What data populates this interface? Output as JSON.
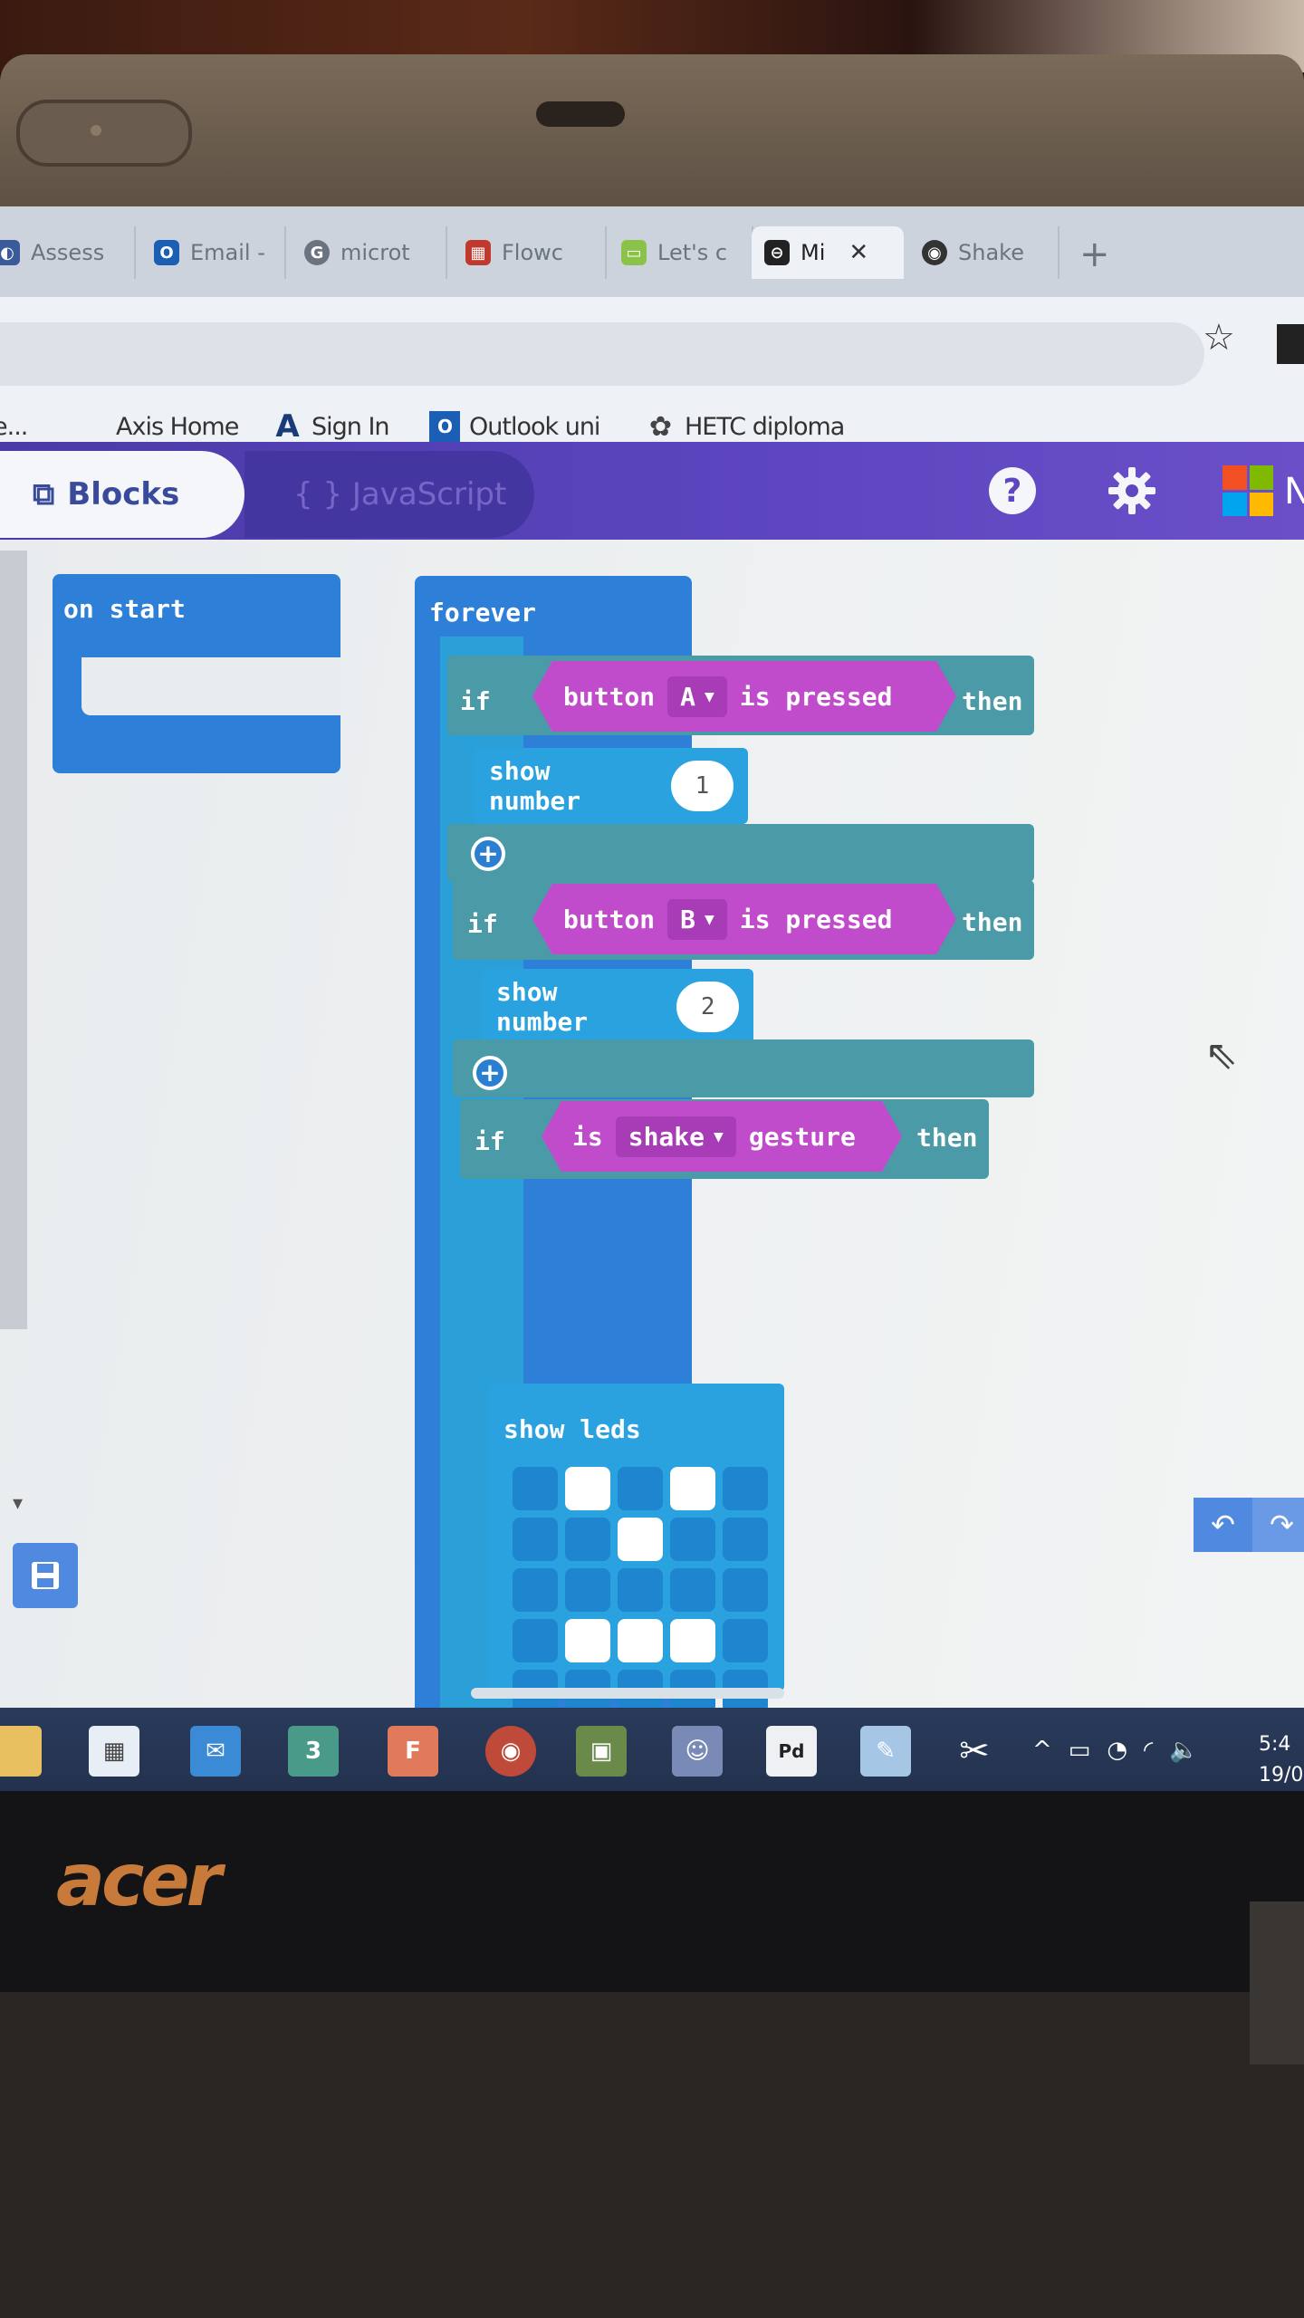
{
  "browser": {
    "tabs": [
      {
        "label": "Assess",
        "icon": "assess-icon",
        "color": "#3a5a9a"
      },
      {
        "label": "Email -",
        "icon": "outlook-icon",
        "color": "#1a5fb4"
      },
      {
        "label": "microt",
        "icon": "google-icon",
        "color": "#555555"
      },
      {
        "label": "Flowc",
        "icon": "flowchart-icon",
        "color": "#c0392b"
      },
      {
        "label": "Let's c",
        "icon": "letsc-icon",
        "color": "#4caf50"
      },
      {
        "label": "Mi",
        "icon": "microbit-icon",
        "color": "#222222",
        "active": true
      },
      {
        "label": "Shake",
        "icon": "github-icon",
        "color": "#333333"
      }
    ],
    "new_tab": "+",
    "bookmarks": [
      {
        "label": "e...",
        "icon": ""
      },
      {
        "label": "Axis Home",
        "icon": ""
      },
      {
        "label": "Sign In",
        "icon": "sign-in-icon"
      },
      {
        "label": "Outlook uni",
        "icon": "outlook-icon"
      },
      {
        "label": "HETC diploma",
        "icon": "hetc-icon"
      }
    ]
  },
  "editor": {
    "blocks_tab": "Blocks",
    "javascript_tab": "{ } JavaScript",
    "help": "?",
    "partial_label": "N",
    "accent": "#5d46c0",
    "on_start": "on start",
    "forever": "forever",
    "if_blocks": [
      {
        "if": "if",
        "cond_prefix": "button",
        "dropdown": "A",
        "cond_suffix": "is pressed",
        "then": "then",
        "action": "show number",
        "value": "1"
      },
      {
        "if": "if",
        "cond_prefix": "button",
        "dropdown": "B",
        "cond_suffix": "is pressed",
        "then": "then",
        "action": "show number",
        "value": "2"
      },
      {
        "if": "if",
        "cond_prefix": "is",
        "dropdown": "shake",
        "cond_suffix": "gesture",
        "then": "then",
        "action": "show leds"
      }
    ],
    "leds": [
      [
        0,
        1,
        0,
        1,
        0
      ],
      [
        0,
        0,
        1,
        0,
        0
      ],
      [
        0,
        0,
        0,
        0,
        0
      ],
      [
        0,
        1,
        1,
        1,
        0
      ],
      [
        0,
        0,
        0,
        0,
        0
      ]
    ]
  },
  "taskbar": {
    "items": [
      "file-explorer-icon",
      "store-icon",
      "mail-icon",
      "3",
      "F",
      "chrome-icon",
      "minecraft-icon",
      "discord-icon",
      "Pd",
      "paint-icon",
      "snipping-icon"
    ],
    "pd_label": "Pd",
    "three_label": "3",
    "f_label": "F",
    "clock_time": "5:4",
    "clock_date": "19/0"
  },
  "hardware": {
    "brand": "acer"
  }
}
